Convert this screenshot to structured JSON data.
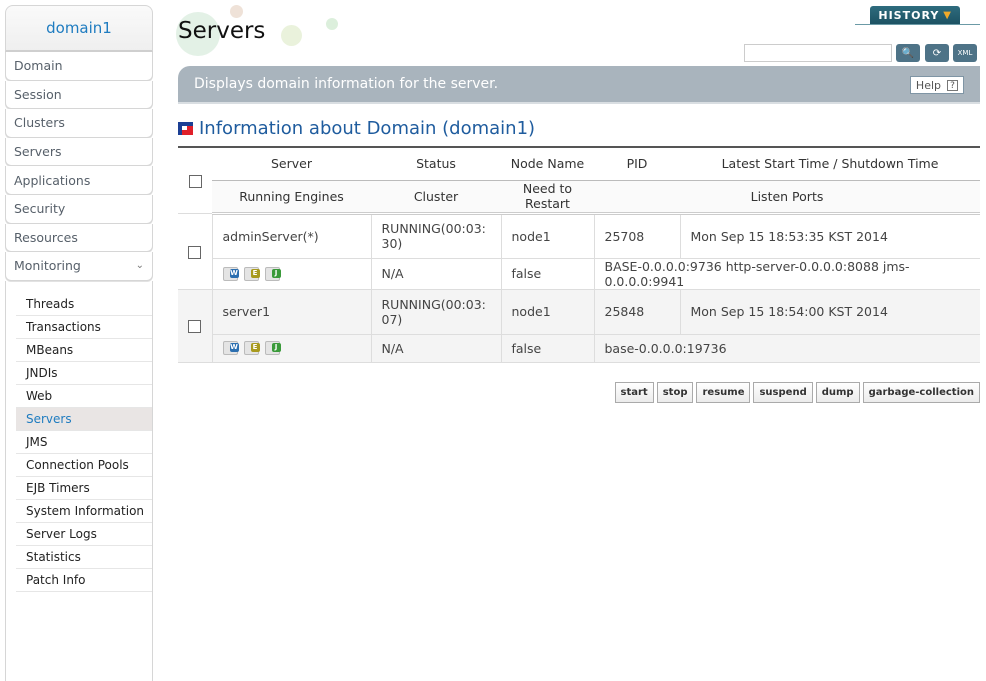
{
  "sidebar": {
    "domain": "domain1",
    "menu": [
      {
        "label": "Domain"
      },
      {
        "label": "Session"
      },
      {
        "label": "Clusters"
      },
      {
        "label": "Servers"
      },
      {
        "label": "Applications"
      },
      {
        "label": "Security"
      },
      {
        "label": "Resources"
      },
      {
        "label": "Monitoring",
        "icon": "chevron-down-icon"
      }
    ],
    "submenu": [
      {
        "label": "Threads"
      },
      {
        "label": "Transactions"
      },
      {
        "label": "MBeans"
      },
      {
        "label": "JNDIs"
      },
      {
        "label": "Web"
      },
      {
        "label": "Servers",
        "active": true
      },
      {
        "label": "JMS"
      },
      {
        "label": "Connection Pools"
      },
      {
        "label": "EJB Timers"
      },
      {
        "label": "System Information"
      },
      {
        "label": "Server Logs"
      },
      {
        "label": "Statistics"
      },
      {
        "label": "Patch Info"
      }
    ]
  },
  "header": {
    "title": "Servers",
    "history_label": "HISTORY",
    "search": {
      "value": "",
      "placeholder": ""
    },
    "tools": [
      "search-icon",
      "refresh-icon",
      "xml-export-icon"
    ],
    "banner_text": "Displays domain information for the server.",
    "help_label": "Help",
    "help_glyph": "?"
  },
  "section": {
    "title": "Information about Domain (domain1)"
  },
  "table": {
    "headers_top": [
      "Server",
      "Status",
      "Node Name",
      "PID",
      "Latest Start Time / Shutdown Time"
    ],
    "headers_bottom": [
      "Running Engines",
      "Cluster",
      "Need to Restart",
      "Listen Ports"
    ],
    "rows": [
      {
        "server": "adminServer(*)",
        "status": "RUNNING(00:03:30)",
        "node": "node1",
        "pid": "25708",
        "time": "Mon Sep 15 18:53:35 KST 2014",
        "engines": [
          "W",
          "E",
          "J"
        ],
        "cluster": "N/A",
        "restart": "false",
        "ports": "BASE-0.0.0.0:9736 http-server-0.0.0.0:8088 jms-0.0.0.0:9941"
      },
      {
        "server": "server1",
        "status": "RUNNING(00:03:07)",
        "node": "node1",
        "pid": "25848",
        "time": "Mon Sep 15 18:54:00 KST 2014",
        "engines": [
          "W",
          "E",
          "J"
        ],
        "cluster": "N/A",
        "restart": "false",
        "ports": "base-0.0.0.0:19736"
      }
    ]
  },
  "actions": [
    "start",
    "stop",
    "resume",
    "suspend",
    "dump",
    "garbage-collection"
  ],
  "colors": {
    "accent": "#1f7cc0",
    "engine_web": "#2c6fb0",
    "engine_ejb": "#a89a1e",
    "engine_jms": "#3a9a3a"
  }
}
